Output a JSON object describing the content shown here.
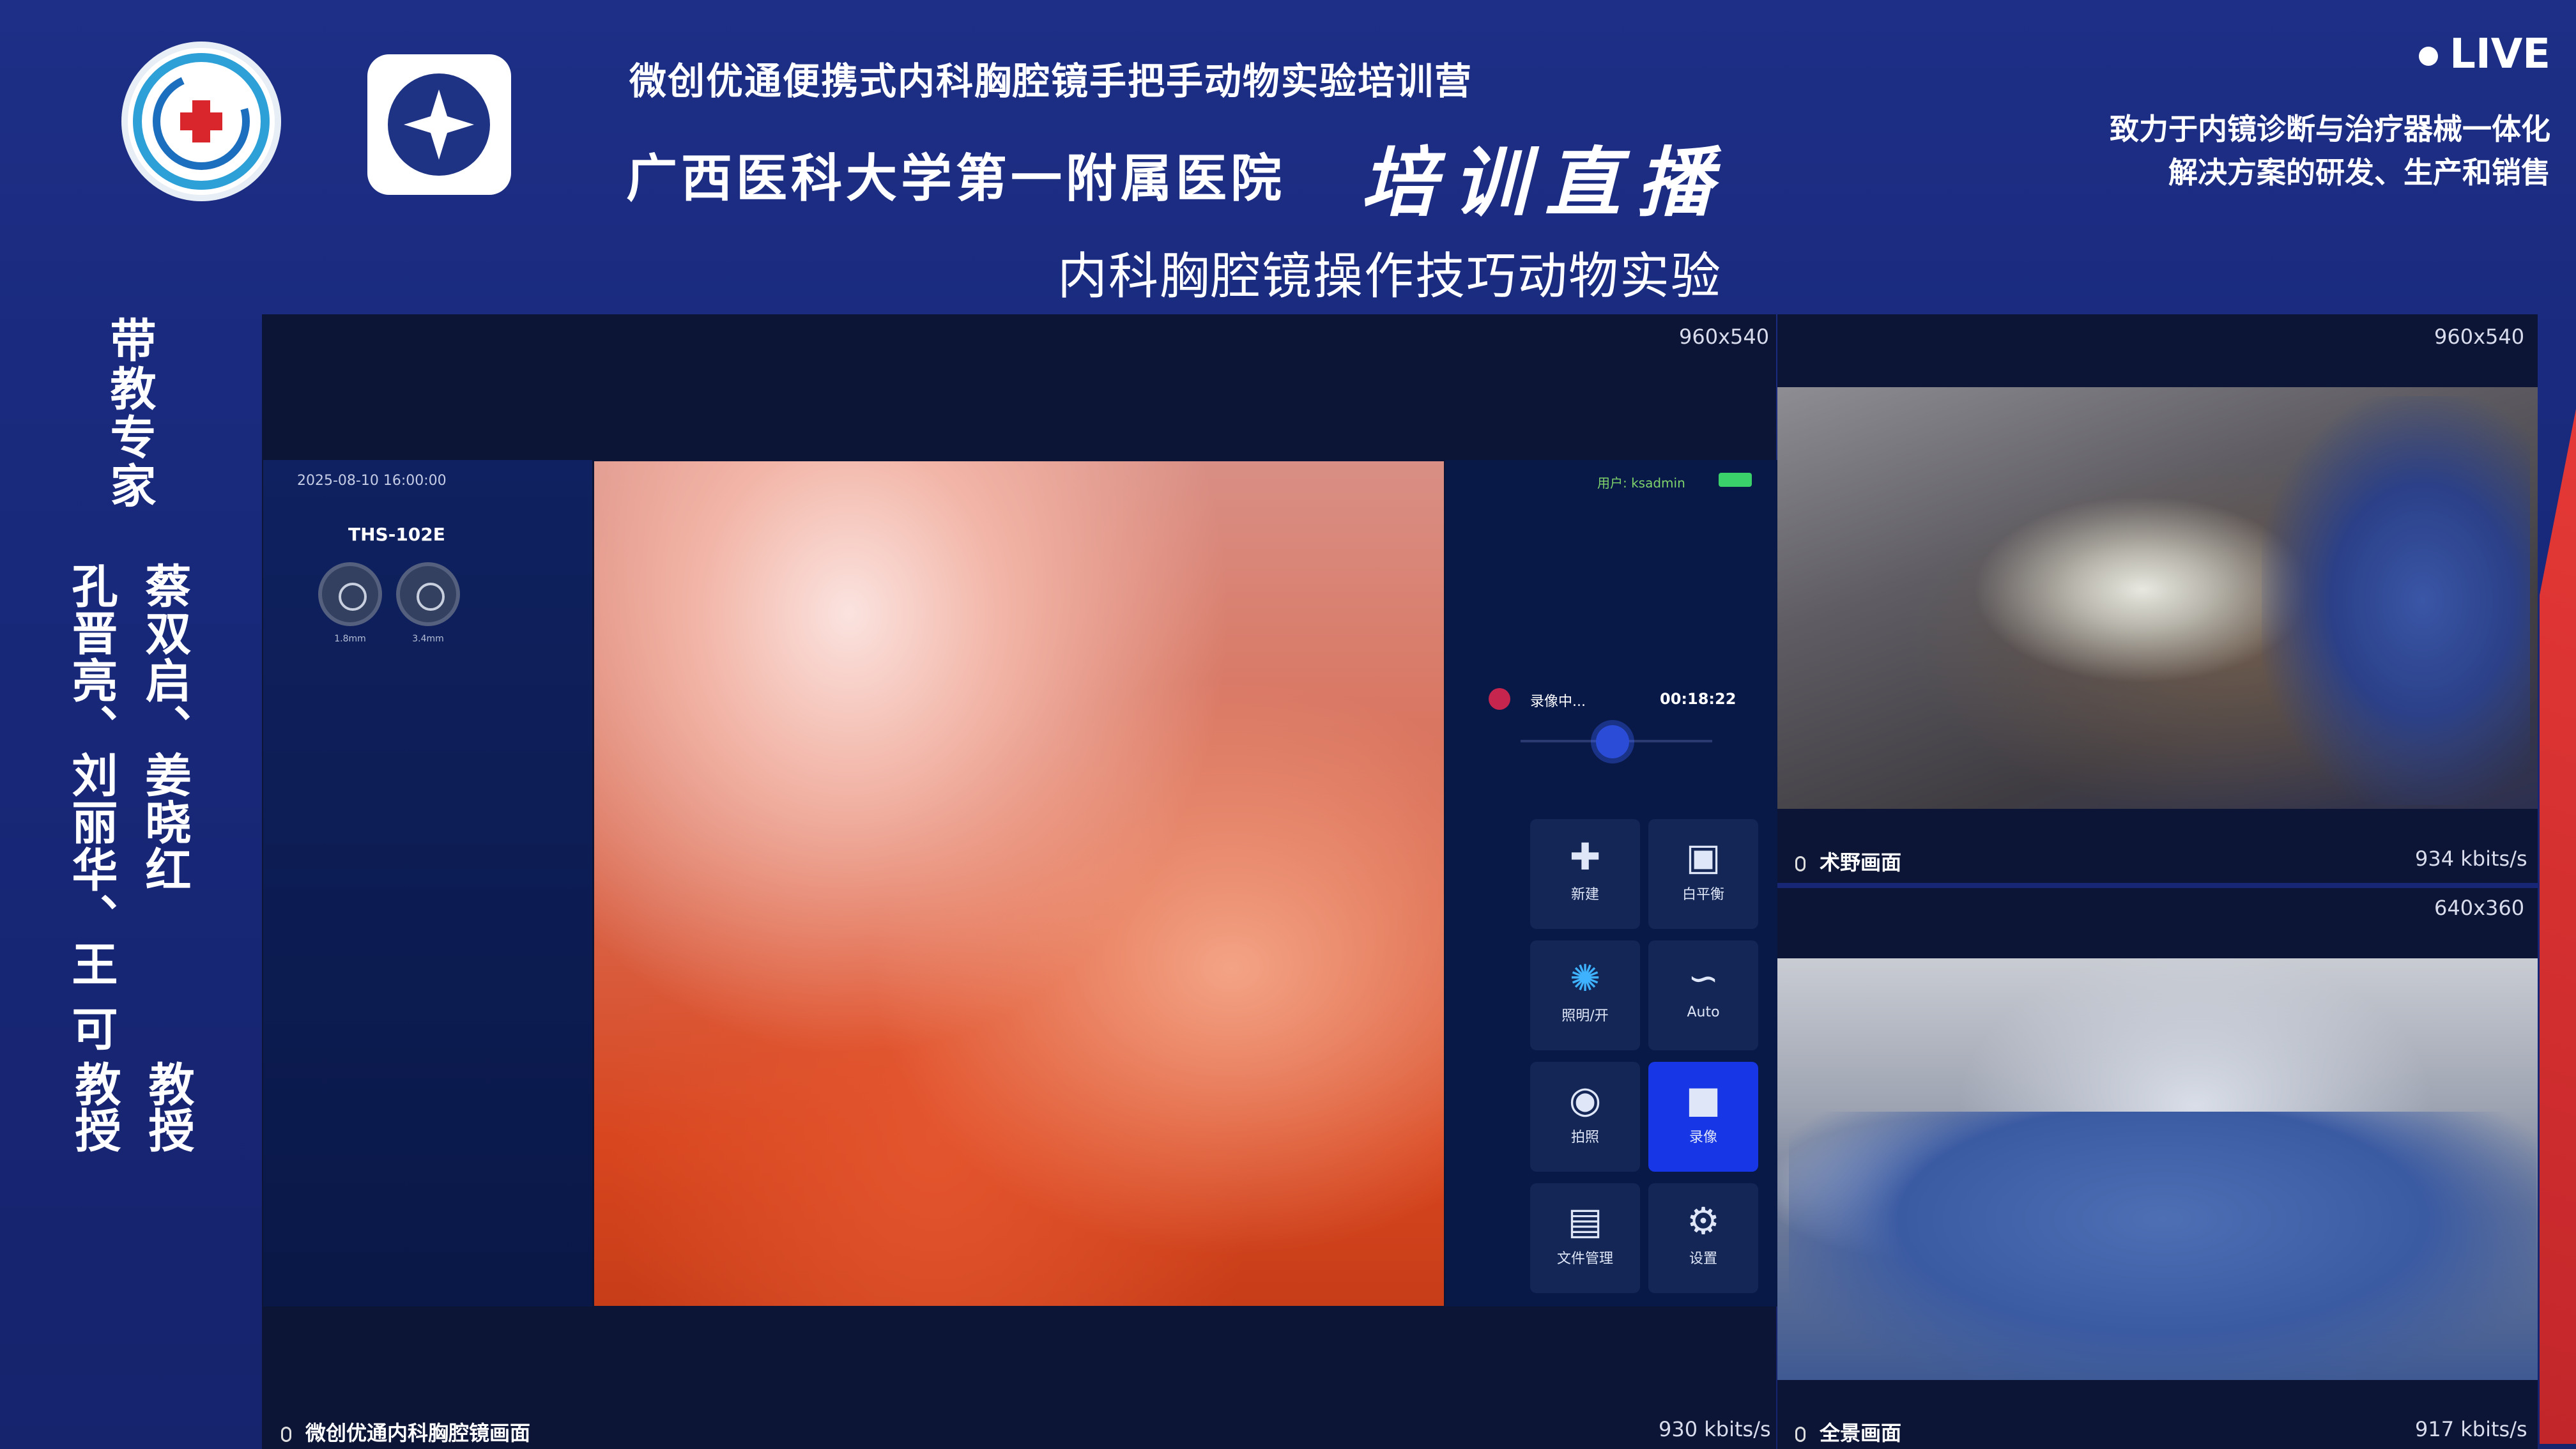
{
  "header": {
    "subtitle": "微创优通便携式内科胸腔镜手把手动物实验培训营",
    "hospital": "广西医科大学第一附属医院",
    "brush_title": "培训直播",
    "topic": "内科胸腔镜操作技巧动物实验",
    "live": "LIVE",
    "tagline_line1": "致力于内镜诊断与治疗器械一体化",
    "tagline_line2": "解决方案的研发、生产和销售"
  },
  "sidebar": {
    "label": "带教专家",
    "names_col1": "蔡双启、姜晓红",
    "names_col2": "孔晋亮、刘丽华、王 可",
    "title_col1": "教授",
    "title_col2": "教授"
  },
  "main_stream": {
    "resolution": "960x540",
    "label": "微创优通内科胸腔镜画面",
    "bitrate": "930 kbits/s",
    "device": {
      "datetime": "2025-08-10 16:00:00",
      "model": "THS-102E",
      "dial1": "1.8mm",
      "dial2": "3.4mm",
      "status": "用户: ksadmin",
      "rec_text": "录像中...",
      "rec_time": "00:18:22",
      "buttons": [
        {
          "icon": "新建",
          "label": "新建",
          "glyph": "✚"
        },
        {
          "icon": "white-balance-icon",
          "label": "白平衡",
          "glyph": "▣"
        },
        {
          "icon": "light-icon",
          "label": "照明/开",
          "glyph": "✺"
        },
        {
          "icon": "auto-icon",
          "label": "Auto",
          "glyph": "∽"
        },
        {
          "icon": "camera-icon",
          "label": "拍照",
          "glyph": "◉"
        },
        {
          "icon": "video-icon",
          "label": "录像",
          "glyph": "■"
        },
        {
          "icon": "folder-icon",
          "label": "文件管理",
          "glyph": "▤"
        },
        {
          "icon": "gear-icon",
          "label": "设置",
          "glyph": "⚙"
        }
      ]
    }
  },
  "cam_surgical": {
    "resolution": "960x540",
    "label": "术野画面",
    "bitrate": "934 kbits/s"
  },
  "cam_room": {
    "resolution": "640x360",
    "label": "全景画面",
    "bitrate": "917 kbits/s"
  },
  "colors": {
    "background": "#1a2b80",
    "panel": "#0c1535",
    "accent_red": "#e53936",
    "active_button": "#1736e5"
  }
}
